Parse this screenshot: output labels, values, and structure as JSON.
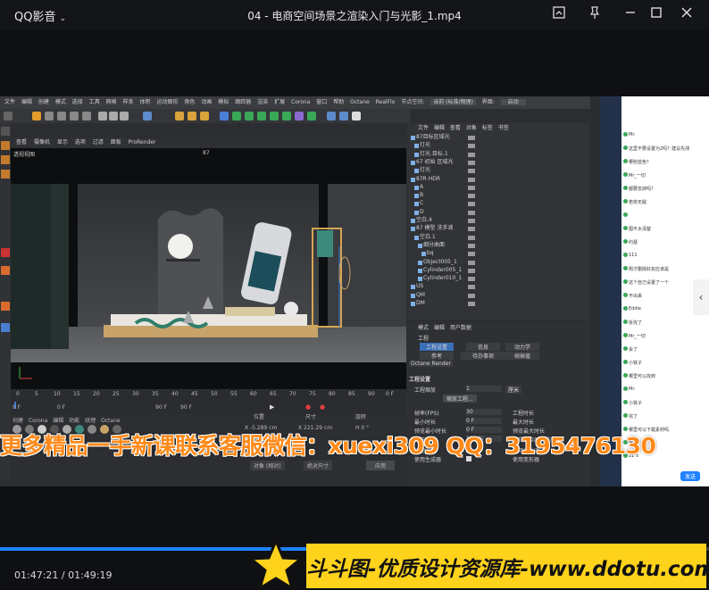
{
  "player": {
    "app_name": "QQ影音",
    "file_title": "04 - 电商空间场景之渲染入门与光影_1.mp4",
    "time": "01:47:21 / 01:49:19",
    "progress_fraction": 0.982,
    "accent": "#1f82ff"
  },
  "c4d": {
    "menubar": [
      "文件",
      "编辑",
      "创建",
      "模式",
      "选择",
      "工具",
      "网格",
      "样条",
      "体积",
      "运动图形",
      "角色",
      "动画",
      "模拟",
      "跟踪器",
      "渲染",
      "扩展",
      "Corona",
      "窗口",
      "帮助",
      "Octane",
      "RealFlo",
      "节点空间:",
      "当前 (标准/物理)",
      "界面:",
      "启动"
    ],
    "viewport_menu": [
      "查看",
      "摄像机",
      "显示",
      "选项",
      "过滤",
      "面板",
      "ProRender"
    ],
    "viewport_label": "透视视图",
    "viewport_cam": "87",
    "timeline": {
      "ticks": [
        "0",
        "5",
        "10",
        "15",
        "20",
        "25",
        "30",
        "35",
        "40",
        "45",
        "50",
        "55",
        "60",
        "65",
        "70",
        "75",
        "80",
        "85",
        "90"
      ],
      "frame_a": "0 F",
      "frame_b": "0 F",
      "frame_c": "90 F",
      "frame_d": "90 F",
      "current": "0 F"
    },
    "material_menu": [
      "创建",
      "Corona",
      "编辑",
      "功能",
      "纹理",
      "Octane"
    ],
    "coord": {
      "headers": [
        "位置",
        "尺寸",
        "旋转"
      ],
      "x_pos": "X -5.289 cm",
      "x_size": "X 221.29 cm",
      "h_rot": "H 0 °",
      "mode": "对象 (相对)",
      "size_mode": "绝对尺寸",
      "apply": "应用"
    },
    "object_manager": {
      "menu": [
        "文件",
        "编辑",
        "查看",
        "对象",
        "标签",
        "书签"
      ],
      "rows": [
        "87目标区域光",
        "灯光",
        "灯光.目标.1",
        "67 初始 区域光",
        "灯光",
        "87R HDR",
        "A",
        "B",
        "C",
        "D",
        "空白.4",
        "87 模型 洗手液",
        "空白.1",
        "细分曲面",
        "bq",
        "Object005_1",
        "Cylinder005_1",
        "Cylinder010_1",
        "US",
        "QM",
        "DM"
      ]
    },
    "attributes": {
      "menu": [
        "模式",
        "编辑",
        "用户数据"
      ],
      "title": "工程",
      "tabs": [
        "工程设置",
        "信息",
        "动力学",
        "参考",
        "待办事项",
        "帧插值"
      ],
      "renderer": "Octane Render",
      "section": "工程设置",
      "scale_label": "工程缩放",
      "scale_value": "1",
      "scale_unit": "厘米",
      "scale_btn": "缩放工程...",
      "fps_label": "帧率(FPS)",
      "fps_value": "30",
      "min_label": "最小时长",
      "min_value": "0 F",
      "preview_label": "预览最小时长",
      "preview_value": "0 F",
      "lod_label": "细节程度",
      "lod_value": "100 %",
      "anim_label": "使用动画",
      "gen_label": "使用生成器",
      "proj_time": "工程时长",
      "max_time": "最大时长",
      "preview_max": "预览最大时长",
      "edit_lod": "编辑渲染细节程度",
      "expr": "使用表达式",
      "deform": "使用变形器"
    }
  },
  "chat": {
    "lines": [
      "Mr.",
      "这里不要设置为2吗？建议先测",
      "哪些蓝色？",
      "Mr_一切",
      "都要去掉吗？",
      "若依无敌",
      "",
      "图不太清楚",
      "约瑟",
      "111",
      "刚才删除好友应该是",
      "这个自己设置了一个",
      "不出来",
      "Eddie",
      "拆完了",
      "Mr_一切",
      "会了",
      "小铁子",
      "哪里可以找到",
      "Mr.",
      "小铁子",
      "完了",
      "哪里可以下载素材吗",
      "Mr.",
      "21 5"
    ],
    "send_btn": "发送"
  },
  "watermark": {
    "text": "更多精品一手新课联系客服微信：xuexi309 QQ：3195476130",
    "color": "#ff8a1a"
  },
  "banner": {
    "text": "斗斗图-优质设计资源库-www.ddotu.com",
    "color": "#ffd21c"
  },
  "icons": [
    "chevron-down-icon",
    "screenshot-icon",
    "pin-icon",
    "minimize-icon",
    "maximize-icon",
    "close-icon",
    "star-icon"
  ]
}
